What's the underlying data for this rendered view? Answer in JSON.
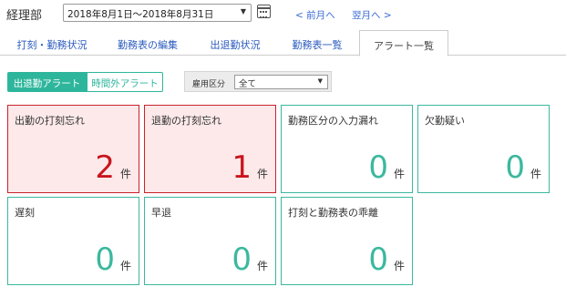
{
  "header": {
    "department": "経理部",
    "period": "2018年8月1日～2018年8月31日",
    "prev_month": "< 前月へ",
    "next_month": "翌月へ >"
  },
  "tabs": [
    {
      "label": "打刻・勤務状況",
      "active": false
    },
    {
      "label": "勤務表の編集",
      "active": false
    },
    {
      "label": "出退勤状況",
      "active": false
    },
    {
      "label": "勤務表一覧",
      "active": false
    },
    {
      "label": "アラート一覧",
      "active": true
    }
  ],
  "alert_type": {
    "options": [
      "出退勤アラート",
      "時間外アラート"
    ],
    "selected": "出退勤アラート"
  },
  "employment_filter": {
    "label": "雇用区分",
    "value": "全て"
  },
  "unit": "件",
  "cards": [
    {
      "title": "出勤の打刻忘れ",
      "count": "2",
      "highlight": true
    },
    {
      "title": "退勤の打刻忘れ",
      "count": "1",
      "highlight": true
    },
    {
      "title": "勤務区分の入力漏れ",
      "count": "0",
      "highlight": false
    },
    {
      "title": "欠勤疑い",
      "count": "0",
      "highlight": false
    },
    {
      "title": "遅刻",
      "count": "0",
      "highlight": false
    },
    {
      "title": "早退",
      "count": "0",
      "highlight": false
    },
    {
      "title": "打刻と勤務表の乖離",
      "count": "0",
      "highlight": false
    }
  ],
  "colors": {
    "accent": "#2eb69c",
    "alert_bg": "#fde9ea",
    "alert_border": "#c9222b",
    "alert_text": "#c9151d",
    "link": "#3a6bd6"
  }
}
